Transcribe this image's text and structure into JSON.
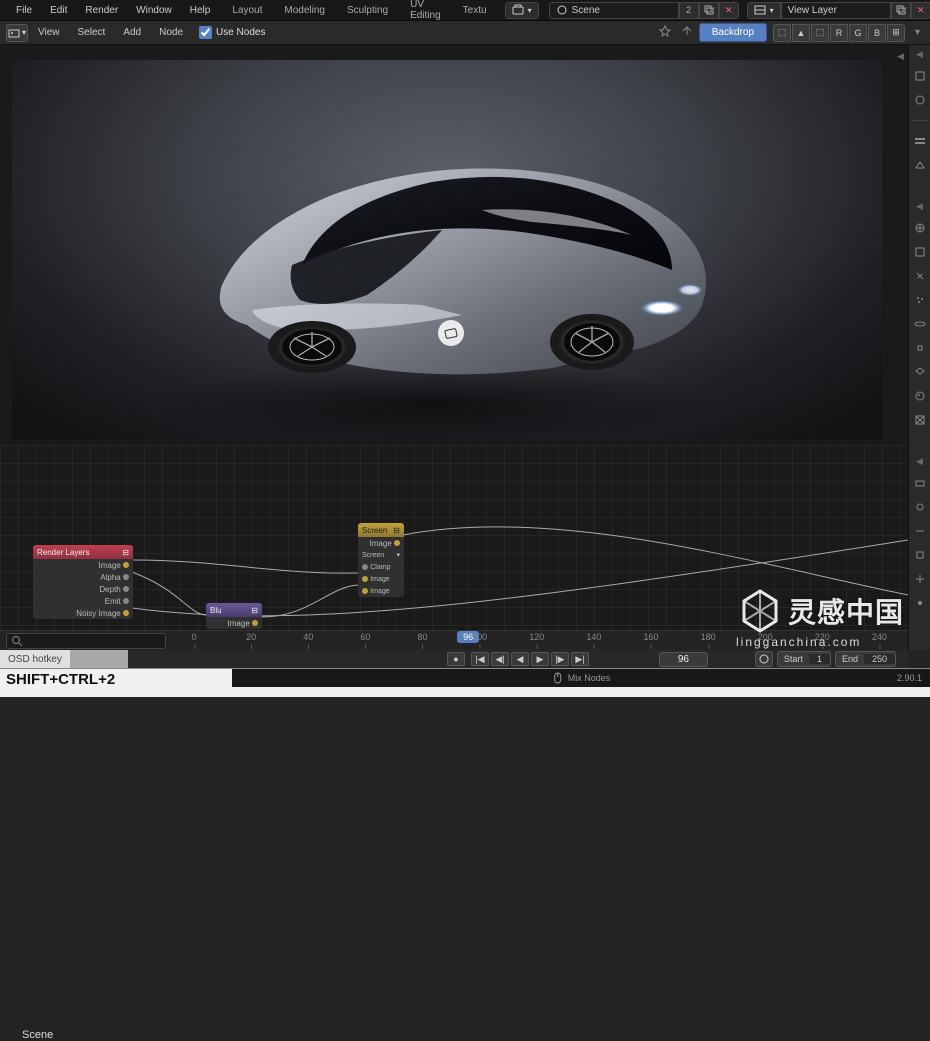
{
  "menubar": {
    "items": [
      "File",
      "Edit",
      "Render",
      "Window",
      "Help"
    ],
    "tabs": [
      "Layout",
      "Modeling",
      "Sculpting",
      "UV Editing",
      "Textu"
    ],
    "scene_icon": "scene-icon",
    "scene": "Scene",
    "scene_count": "2",
    "viewlayer": "View Layer"
  },
  "toolbar": {
    "items": [
      "View",
      "Select",
      "Add",
      "Node"
    ],
    "use_nodes": "Use Nodes",
    "backdrop": "Backdrop",
    "channels": [
      "⬚",
      "▲",
      "⬚",
      "R",
      "G",
      "B",
      "⊞"
    ]
  },
  "nodes": {
    "render_layers": {
      "title": "Render Layers",
      "out": [
        "Image",
        "Alpha",
        "Depth",
        "Emit",
        "Noisy Image"
      ]
    },
    "blur": {
      "title": "Blu",
      "out": "Image"
    },
    "screen": {
      "title": "Screen",
      "out_image": "Image",
      "rows": [
        "Screen",
        "Clamp",
        "Image",
        "Image"
      ]
    }
  },
  "scene_label": "Scene",
  "timeline": {
    "ticks": [
      "0",
      "20",
      "40",
      "60",
      "80",
      "100",
      "120",
      "140",
      "160",
      "180",
      "200",
      "220",
      "240"
    ],
    "current": "96",
    "search_placeholder": ""
  },
  "hotkey": {
    "osd": "OSD hotkey"
  },
  "playback": {
    "frame": "96",
    "start_label": "Start",
    "start": "1",
    "end_label": "End",
    "end": "250"
  },
  "status": {
    "big": "SHIFT+CTRL+2",
    "mid_icon": "mouse-icon",
    "mid": "Mix Nodes",
    "version": "2.90.1"
  },
  "watermark": {
    "cn": "灵感中国",
    "url": "lingganchina.com"
  }
}
